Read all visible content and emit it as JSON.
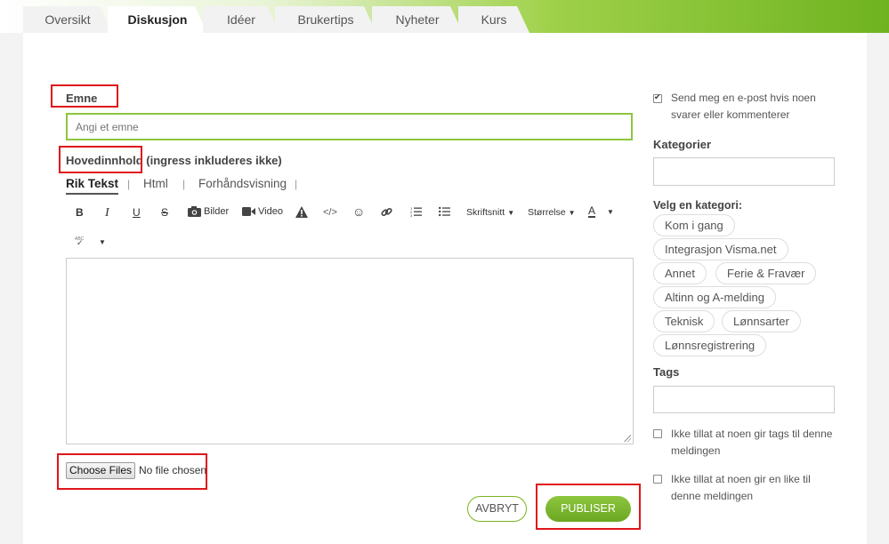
{
  "nav": {
    "tabs": [
      {
        "label": "Oversikt",
        "active": false
      },
      {
        "label": "Diskusjon",
        "active": true
      },
      {
        "label": "Idéer",
        "active": false
      },
      {
        "label": "Brukertips",
        "active": false
      },
      {
        "label": "Nyheter",
        "active": false
      },
      {
        "label": "Kurs",
        "active": false
      }
    ]
  },
  "form": {
    "subject_label": "Emne",
    "subject_placeholder": "Angi et emne",
    "body_label_main": "Hovedinnhold",
    "body_label_note": " (ingress inkluderes ikke)",
    "editor_tabs": [
      "Rik Tekst",
      "Html",
      "Forhåndsvisning"
    ],
    "editor_tab_separator": "|",
    "toolbar": {
      "bold": "B",
      "italic": "I",
      "underline": "U",
      "strike": "S",
      "images": "Bilder",
      "video": "Video",
      "font": "Skriftsnitt",
      "size": "Størrelse",
      "color": "A",
      "spellcheck": "ABC"
    },
    "file_button": "Choose Files",
    "file_status": "No file chosen",
    "cancel": "AVBRYT",
    "publish": "PUBLISER"
  },
  "sidebar": {
    "notify_text": "Send meg en e-post hvis noen svarer eller kommenterer",
    "notify_checked": true,
    "categories_label": "Kategorier",
    "choose_category_label": "Velg en kategori:",
    "categories": [
      "Kom i gang",
      "Integrasjon Visma.net",
      "Annet",
      "Ferie & Fravær",
      "Altinn og A-melding",
      "Teknisk",
      "Lønnsarter",
      "Lønnsregistrering"
    ],
    "tags_label": "Tags",
    "no_tags_text": "Ikke tillat at noen gir tags til denne meldingen",
    "no_likes_text": "Ikke tillat at noen gir en like til denne meldingen"
  },
  "colors": {
    "brand_green": "#7ab51d",
    "highlight_red": "#e0161b"
  }
}
